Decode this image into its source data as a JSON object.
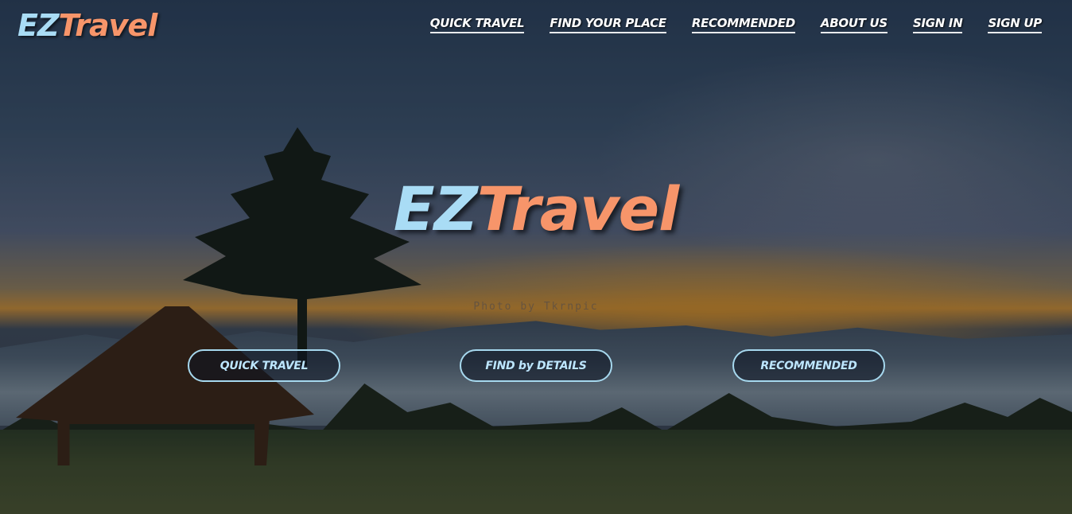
{
  "brand": {
    "part1": "EZ",
    "part2": "Travel",
    "part1_color": "#a9dcf5",
    "part2_color": "#f7956a"
  },
  "nav": {
    "items": [
      {
        "label": "QUICK TRAVEL"
      },
      {
        "label": "FIND YOUR PLACE"
      },
      {
        "label": "RECOMMENDED"
      },
      {
        "label": "ABOUT US"
      },
      {
        "label": "SIGN IN"
      },
      {
        "label": "SIGN UP"
      }
    ]
  },
  "hero": {
    "title_part1": "EZ",
    "title_part2": "Travel",
    "photo_credit": "Photo by Tkrnpic",
    "background_description_icon": "landscape-photo"
  },
  "buttons": [
    {
      "label": "QUICK TRAVEL"
    },
    {
      "label": "FIND by DETAILS"
    },
    {
      "label": "RECOMMENDED"
    }
  ],
  "colors": {
    "button_border": "#a6d8ee",
    "button_text": "#bde6ff",
    "nav_text": "#ffffff"
  }
}
